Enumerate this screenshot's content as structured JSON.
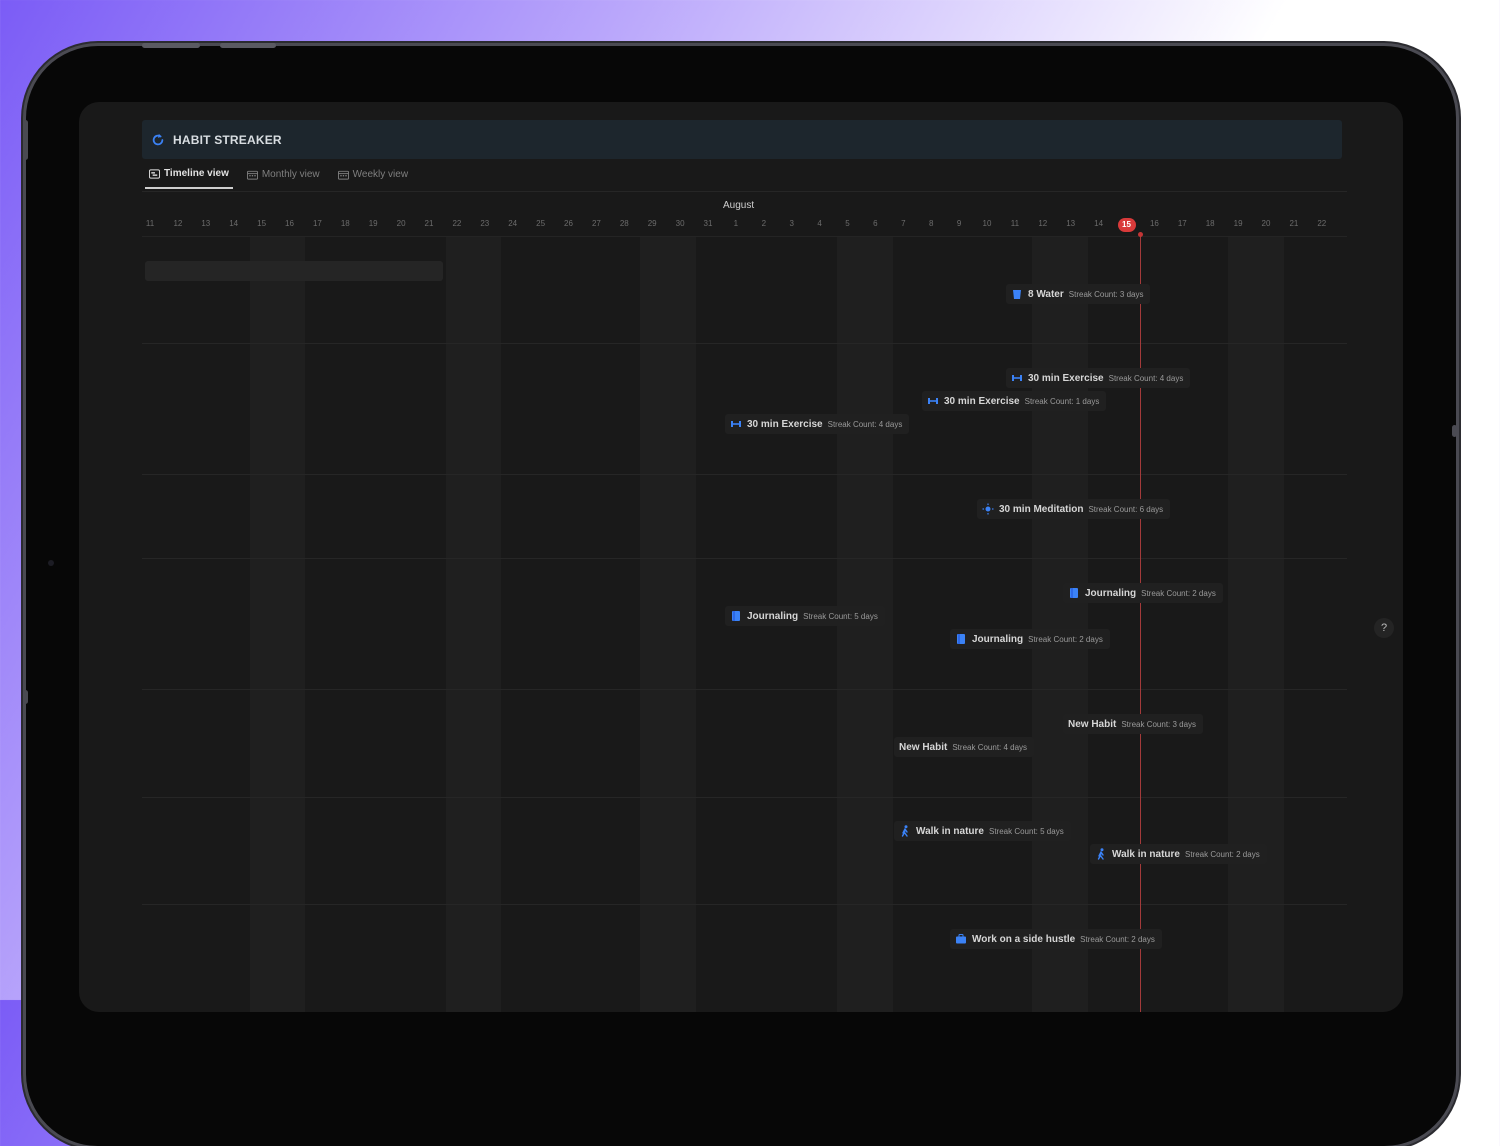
{
  "app": {
    "title": "HABIT STREAKER"
  },
  "tabs": [
    {
      "label": "Timeline view",
      "active": true
    },
    {
      "label": "Monthly view",
      "active": false
    },
    {
      "label": "Weekly view",
      "active": false
    }
  ],
  "timeline": {
    "month_label": "August",
    "dates": [
      "11",
      "12",
      "13",
      "14",
      "15",
      "16",
      "17",
      "18",
      "19",
      "20",
      "21",
      "22",
      "23",
      "24",
      "25",
      "26",
      "27",
      "28",
      "29",
      "30",
      "31",
      "1",
      "2",
      "3",
      "4",
      "5",
      "6",
      "7",
      "8",
      "9",
      "10",
      "11",
      "12",
      "13",
      "14",
      "15",
      "16",
      "17",
      "18",
      "19",
      "20",
      "21",
      "22"
    ],
    "today": "15"
  },
  "entries": [
    {
      "name": "8 Water",
      "streak": "Streak Count: 3 days",
      "icon": "cup-icon"
    },
    {
      "name": "30 min Exercise",
      "streak": "Streak Count: 4 days",
      "icon": "dumbbell-icon"
    },
    {
      "name": "30 min Exercise",
      "streak": "Streak Count: 1 days",
      "icon": "dumbbell-icon"
    },
    {
      "name": "30 min Exercise",
      "streak": "Streak Count: 4 days",
      "icon": "dumbbell-icon"
    },
    {
      "name": "30 min Meditation",
      "streak": "Streak Count: 6 days",
      "icon": "sun-icon"
    },
    {
      "name": "Journaling",
      "streak": "Streak Count: 2 days",
      "icon": "book-icon"
    },
    {
      "name": "Journaling",
      "streak": "Streak Count: 5 days",
      "icon": "book-icon"
    },
    {
      "name": "Journaling",
      "streak": "Streak Count: 2 days",
      "icon": "book-icon"
    },
    {
      "name": "New Habit",
      "streak": "Streak Count: 3 days",
      "icon": ""
    },
    {
      "name": "New Habit",
      "streak": "Streak Count: 4 days",
      "icon": ""
    },
    {
      "name": "Walk in nature",
      "streak": "Streak Count: 5 days",
      "icon": "walker-icon"
    },
    {
      "name": "Walk in nature",
      "streak": "Streak Count: 2 days",
      "icon": "walker-icon"
    },
    {
      "name": "Work on a side hustle",
      "streak": "Streak Count: 2 days",
      "icon": "briefcase-icon"
    }
  ],
  "help": {
    "label": "?"
  },
  "colors": {
    "accent": "#3b82f6",
    "today": "#d93a3a",
    "background": "#191919"
  }
}
